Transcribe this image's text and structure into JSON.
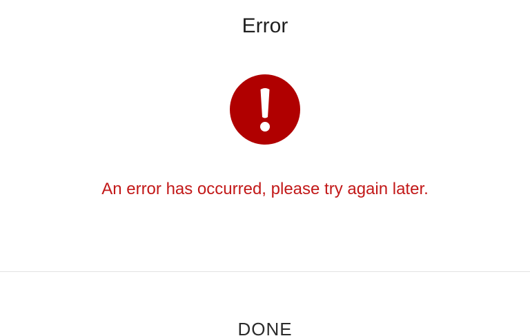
{
  "dialog": {
    "title": "Error",
    "icon": "error-exclamation-icon",
    "message": "An error has occurred, please try again later.",
    "done_label": "DONE"
  },
  "colors": {
    "error_red": "#b00000",
    "message_red": "#c21818",
    "title_text": "#1f1f1f",
    "divider": "#e3e3e3"
  }
}
